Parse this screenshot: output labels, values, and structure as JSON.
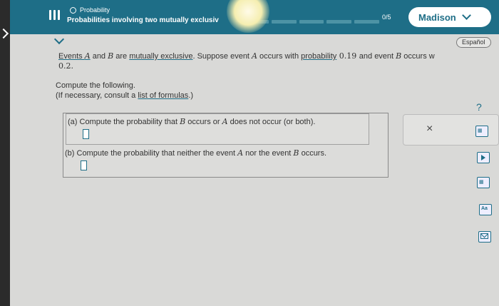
{
  "header": {
    "topic_small": "Probability",
    "topic_title": "Probabilities involving two mutually exclusiv",
    "progress_label": "0/5",
    "user_name": "Madison"
  },
  "language_button": "Español",
  "statement": {
    "t1": "Events ",
    "a": "A",
    "t2": " and ",
    "b": "B",
    "t3": " are ",
    "link_mutex": "mutually exclusive",
    "t4": ". Suppose event ",
    "t5": " occurs with ",
    "link_prob": "probability",
    "pa": " 0.19 ",
    "t6": "and event ",
    "t7": " occurs w",
    "line2": "0.2."
  },
  "compute": {
    "line1": "Compute the following.",
    "line2_pre": "(If necessary, consult a ",
    "line2_link": "list of formulas",
    "line2_post": ".)"
  },
  "part_a": {
    "p1": "(a) Compute the probability that ",
    "b": "B",
    "p2": " occurs or ",
    "a": "A",
    "p3": " does not occur (or both)."
  },
  "part_b": {
    "p1": "(b) Compute the probability that neither the event ",
    "a": "A",
    "p2": " nor the event ",
    "b": "B",
    "p3": " occurs."
  },
  "tools": {
    "clear": "×",
    "help": "?",
    "aa": "Aa"
  },
  "colors": {
    "header_bg": "#1e6e87",
    "accent": "#1e6e87"
  }
}
